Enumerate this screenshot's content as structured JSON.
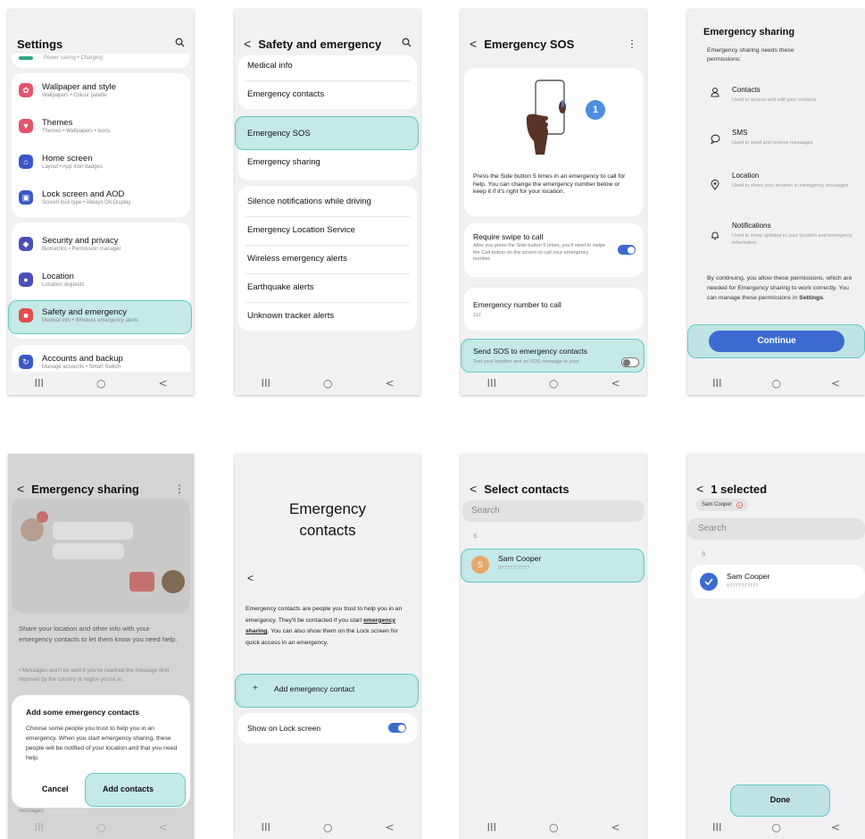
{
  "nav": {
    "recent": "III",
    "home": "○",
    "back": "<"
  },
  "settings": {
    "title": "Settings",
    "top_sub": "Power saving • Charging",
    "items": [
      {
        "label": "Wallpaper and style",
        "sub": "Wallpapers • Colour palette",
        "color": "#e4546b"
      },
      {
        "label": "Themes",
        "sub": "Themes • Wallpapers • Icons",
        "color": "#e4546b"
      },
      {
        "label": "Home screen",
        "sub": "Layout • App icon badges",
        "color": "#3a58c7"
      },
      {
        "label": "Lock screen and AOD",
        "sub": "Screen lock type • Always On Display",
        "color": "#3a58c7"
      },
      {
        "label": "Security and privacy",
        "sub": "Biometrics • Permission manager",
        "color": "#4a4fb8"
      },
      {
        "label": "Location",
        "sub": "Location requests",
        "color": "#4a4fb8"
      },
      {
        "label": "Safety and emergency",
        "sub": "Medical info • Wireless emergency alerts",
        "color": "#e24e4e"
      },
      {
        "label": "Accounts and backup",
        "sub": "Manage accounts • Smart Switch",
        "color": "#3a58c7"
      }
    ]
  },
  "safety": {
    "title": "Safety and emergency",
    "items": [
      "Medical info",
      "Emergency contacts",
      "Emergency SOS",
      "Emergency sharing",
      "Silence notifications while driving",
      "Emergency Location Service",
      "Wireless emergency alerts",
      "Earthquake alerts",
      "Unknown tracker alerts"
    ]
  },
  "sos": {
    "title": "Emergency SOS",
    "badge": "1",
    "description": "Press the Side button 5 times in an emergency to call for help. You can change the emergency number below or keep it if it's right for your location.",
    "swipe_title": "Require swipe to call",
    "swipe_sub": "After you press the Side button 5 times, you'll need to swipe the Call button on the screen to call your emergency number.",
    "number_title": "Emergency number to call",
    "number_value": "112",
    "send_title": "Send SOS to emergency contacts",
    "send_sub": "Text your location and an SOS message to your"
  },
  "sharing_perm": {
    "title": "Emergency sharing",
    "intro": "Emergency sharing needs these permissions:",
    "perms": [
      {
        "name": "Contacts",
        "desc": "Used to access and edit your contacts"
      },
      {
        "name": "SMS",
        "desc": "Used to send and receive messages"
      },
      {
        "name": "Location",
        "desc": "Used to share your location in emergency messages"
      },
      {
        "name": "Notifications",
        "desc": "Used to show updates to your location and emergency information"
      }
    ],
    "footer_pre": "By continuing, you allow these permissions, which are needed for Emergency sharing to work correctly. You can manage these permissions in ",
    "footer_bold": "Settings",
    "footer_end": ".",
    "continue": "Continue"
  },
  "sharing_dialog": {
    "title": "Emergency sharing",
    "desc": "Share your location and other info with your emergency contacts to let them know you need help.",
    "note": "• Messages won't be sent if you've reached the message limit imposed by the country or region you're in.",
    "bottom_note": "messages.",
    "dialog_title": "Add some emergency contacts",
    "dialog_body": "Choose some people you trust to help you in an emergency. When you start emergency sharing, these people will be notified of your location and that you need help.",
    "cancel": "Cancel",
    "add": "Add contacts"
  },
  "emergency_contacts": {
    "title_line1": "Emergency",
    "title_line2": "contacts",
    "desc_pre": "Emergency contacts are people you trust to help you in an emergency. They'll be contacted if you start ",
    "desc_link": "emergency sharing",
    "desc_post": ". You can also show them on the Lock screen for quick access in an emergency.",
    "add": "Add emergency contact",
    "show_lock": "Show on Lock screen"
  },
  "select_contacts": {
    "title": "Select contacts",
    "search": "Search",
    "section": "S",
    "contact_name": "Sam Cooper",
    "contact_phone": "07777777777",
    "avatar_letter": "S"
  },
  "selected": {
    "title": "1 selected",
    "chip": "Sam Cooper",
    "search": "Search",
    "section": "S",
    "contact_name": "Sam Cooper",
    "contact_phone": "07777777777",
    "done": "Done"
  }
}
